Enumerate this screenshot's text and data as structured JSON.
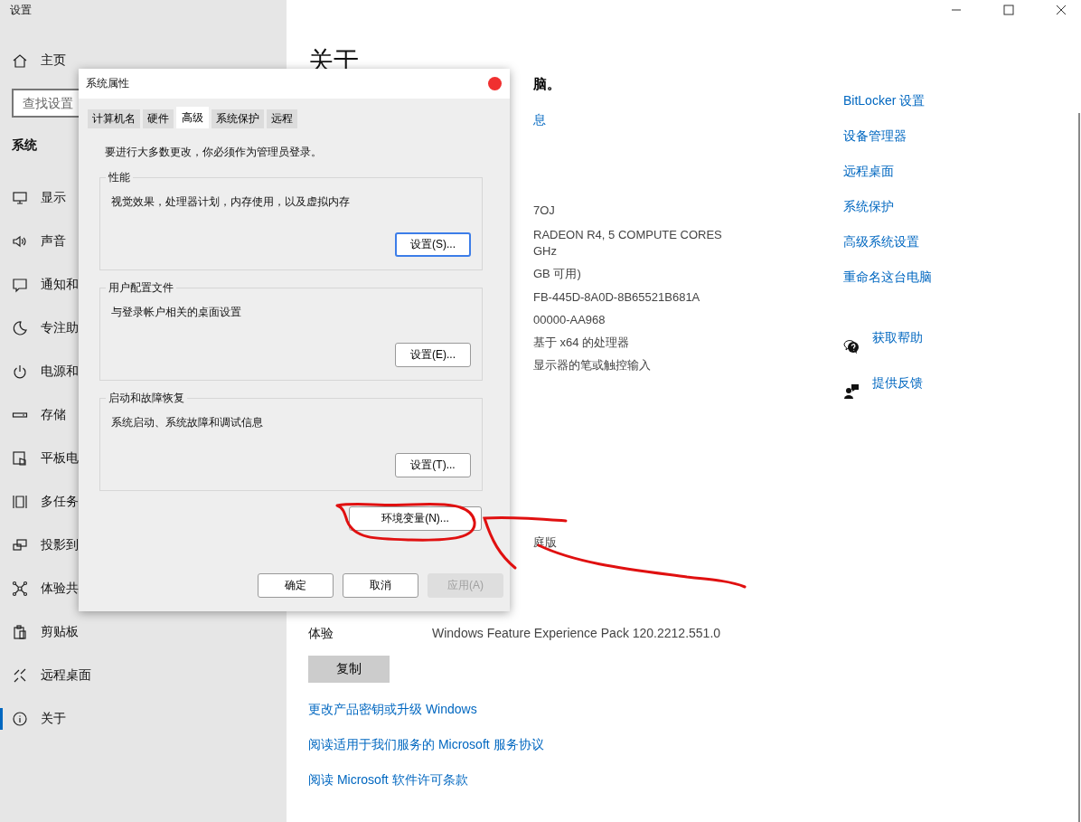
{
  "window": {
    "title": "设置"
  },
  "sidebar": {
    "home": "主页",
    "search": {
      "placeholder": "查找设置"
    },
    "section": "系统",
    "items": [
      {
        "label": "显示",
        "selected": false
      },
      {
        "label": "声音",
        "selected": false
      },
      {
        "label": "通知和",
        "selected": false
      },
      {
        "label": "专注助",
        "selected": false
      },
      {
        "label": "电源和",
        "selected": false
      },
      {
        "label": "存储",
        "selected": false
      },
      {
        "label": "平板电",
        "selected": false
      },
      {
        "label": "多任务",
        "selected": false
      },
      {
        "label": "投影到",
        "selected": false
      },
      {
        "label": "体验共",
        "selected": false
      },
      {
        "label": "剪贴板",
        "selected": false
      },
      {
        "label": "远程桌面",
        "selected": false
      },
      {
        "label": "关于",
        "selected": true
      }
    ]
  },
  "main": {
    "heading": "关于",
    "fragments": [
      {
        "kind": "subtitle",
        "text": "脑。"
      },
      {
        "kind": "link",
        "text": "息"
      },
      {
        "kind": "value",
        "text": "7OJ"
      },
      {
        "kind": "value",
        "text": "RADEON R4, 5 COMPUTE CORES"
      },
      {
        "kind": "value",
        "text": "GHz"
      },
      {
        "kind": "value",
        "text": "GB 可用)"
      },
      {
        "kind": "value",
        "text": "FB-445D-8A0D-8B65521B681A"
      },
      {
        "kind": "value",
        "text": "00000-AA968"
      },
      {
        "kind": "value",
        "text": "基于 x64 的处理器"
      },
      {
        "kind": "value",
        "text": "显示器的笔或触控输入"
      },
      {
        "kind": "value",
        "text": "庭版"
      }
    ],
    "experience": {
      "label": "体验",
      "value": "Windows Feature Experience Pack 120.2212.551.0"
    },
    "copy_button": "复制",
    "links": [
      "更改产品密钥或升级 Windows",
      "阅读适用于我们服务的 Microsoft 服务协议",
      "阅读 Microsoft 软件许可条款"
    ]
  },
  "related": {
    "links": [
      "BitLocker 设置",
      "设备管理器",
      "远程桌面",
      "系统保护",
      "高级系统设置",
      "重命名这台电脑"
    ],
    "help": [
      "获取帮助",
      "提供反馈"
    ]
  },
  "dialog": {
    "title": "系统属性",
    "tabs": [
      {
        "label": "计算机名",
        "selected": false
      },
      {
        "label": "硬件",
        "selected": false
      },
      {
        "label": "高级",
        "selected": true
      },
      {
        "label": "系统保护",
        "selected": false
      },
      {
        "label": "远程",
        "selected": false
      }
    ],
    "notice": "要进行大多数更改，你必须作为管理员登录。",
    "groups": [
      {
        "title": "性能",
        "description": "视觉效果，处理器计划，内存使用，以及虚拟内存",
        "button": {
          "label": "设置(S)...",
          "focused": true
        }
      },
      {
        "title": "用户配置文件",
        "description": "与登录帐户相关的桌面设置",
        "button": {
          "label": "设置(E)...",
          "focused": false
        }
      },
      {
        "title": "启动和故障恢复",
        "description": "系统启动、系统故障和调试信息",
        "button": {
          "label": "设置(T)...",
          "focused": false
        }
      }
    ],
    "env_button": "环境变量(N)...",
    "buttons": [
      {
        "label": "确定",
        "disabled": false
      },
      {
        "label": "取消",
        "disabled": false
      },
      {
        "label": "应用(A)",
        "disabled": true
      }
    ]
  }
}
